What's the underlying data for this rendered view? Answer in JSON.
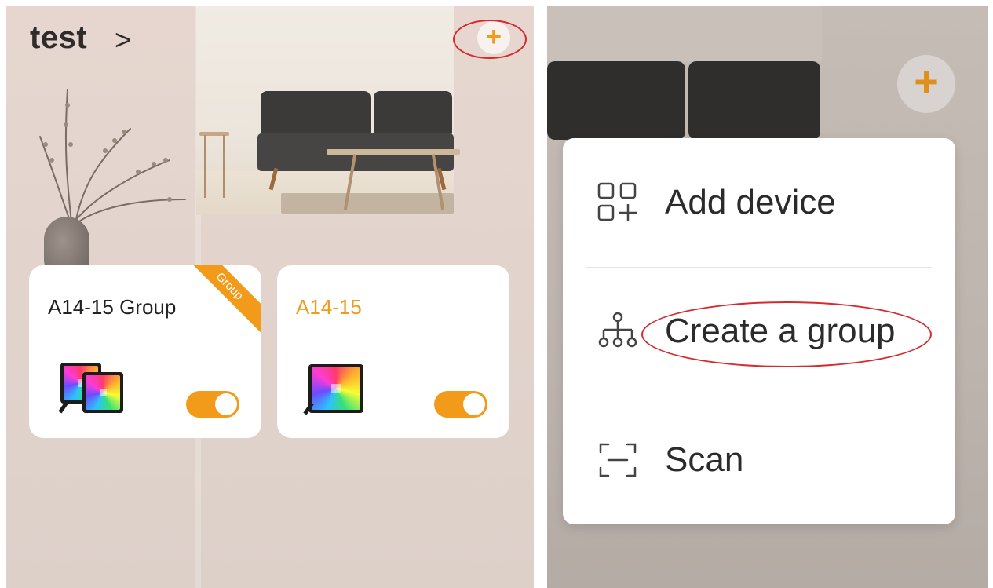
{
  "left_screen": {
    "home": {
      "title": "test",
      "chevron": ">"
    },
    "add_button": {
      "glyph": "+"
    },
    "cards": [
      {
        "title": "A14-15 Group",
        "badge": "Group",
        "title_color": "#222222",
        "toggle_on": true,
        "icon": "led-panel-group-icon"
      },
      {
        "title": "A14-15",
        "title_color": "#f29a1a",
        "toggle_on": true,
        "icon": "led-panel-icon"
      }
    ]
  },
  "right_screen": {
    "add_button": {
      "glyph": "+"
    },
    "menu": [
      {
        "label": "Add device",
        "icon": "add-device-icon"
      },
      {
        "label": "Create a group",
        "icon": "group-hierarchy-icon"
      },
      {
        "label": "Scan",
        "icon": "scan-icon"
      }
    ]
  },
  "colors": {
    "accent": "#f29a1a",
    "highlight": "#d62a2e"
  }
}
